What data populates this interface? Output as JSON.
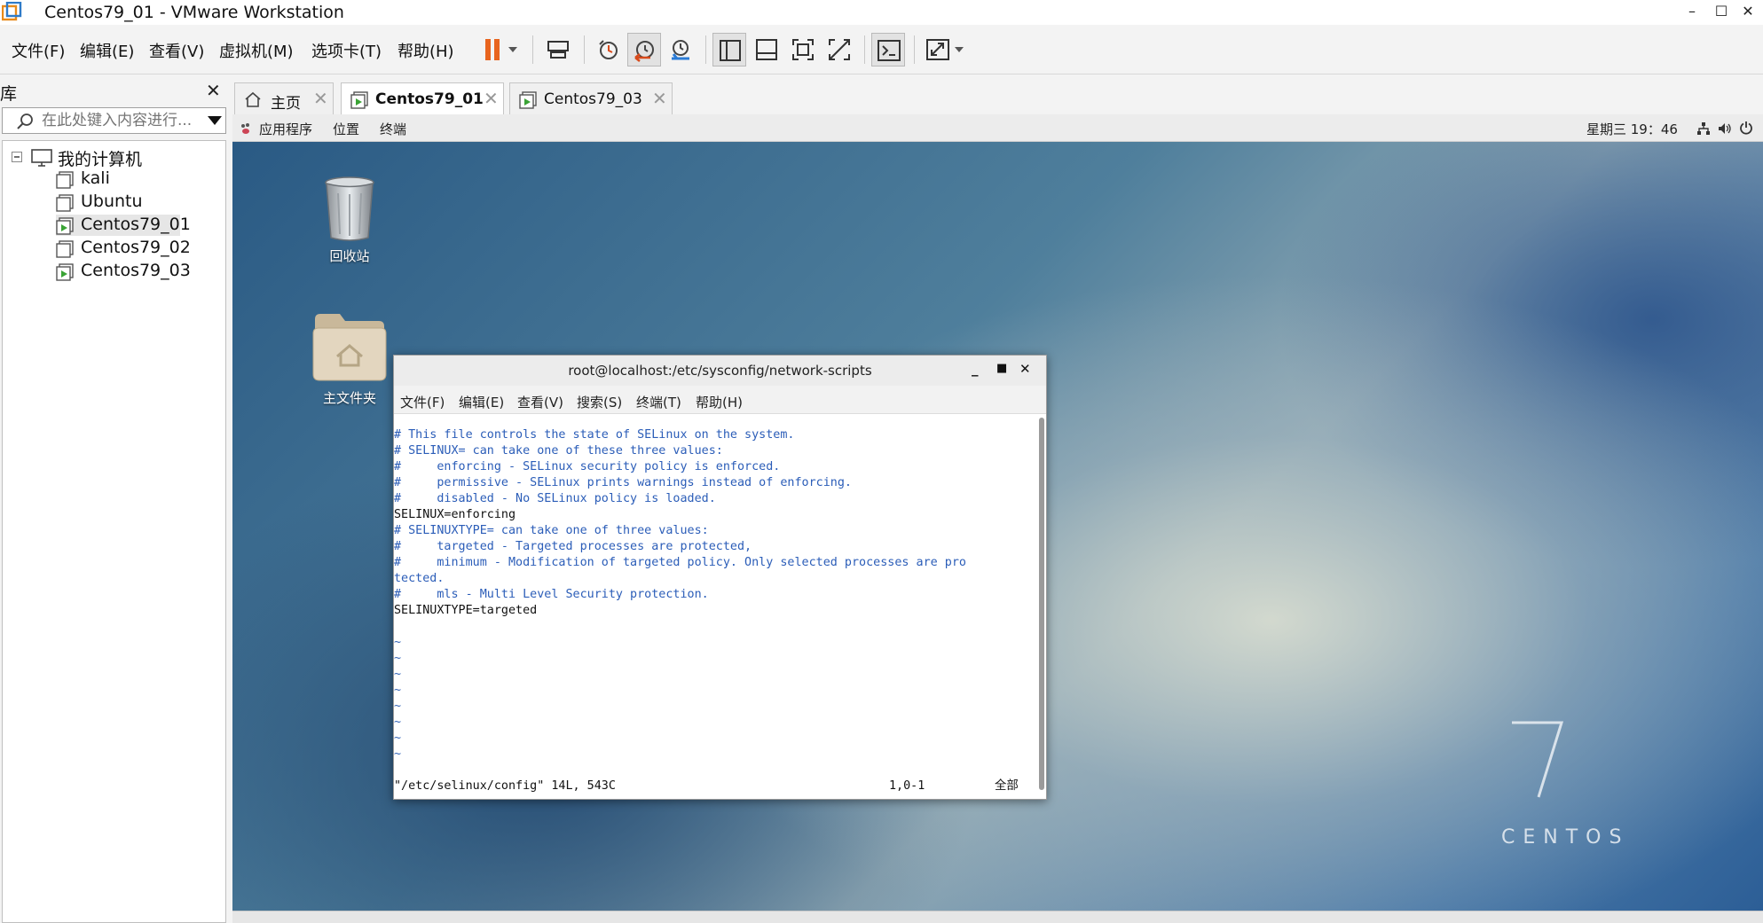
{
  "window": {
    "title": "Centos79_01 - VMware Workstation",
    "minimize": "–",
    "maximize": "☐",
    "close": "✕"
  },
  "menubar": {
    "items": [
      "文件(F)",
      "编辑(E)",
      "查看(V)",
      "虚拟机(M)",
      "选项卡(T)",
      "帮助(H)"
    ]
  },
  "toolbar": {
    "icons": [
      "pause-icon",
      "send-keys-icon",
      "snapshot-icon",
      "revert-snapshot-icon",
      "snapshot-manager-icon",
      "library-view-icon",
      "thumbnail-view-icon",
      "fullscreen-icon",
      "unity-icon",
      "console-icon",
      "stretch-icon"
    ],
    "colors": {
      "pause": "#e8641e",
      "accent_blue": "#2a7bd6",
      "accent_red": "#d84a1b"
    }
  },
  "library": {
    "title": "库",
    "close": "✕",
    "search_placeholder": "在此处键入内容进行...",
    "root": "我的计算机",
    "vms": [
      {
        "name": "kali",
        "running": false
      },
      {
        "name": "Ubuntu",
        "running": false
      },
      {
        "name": "Centos79_01",
        "running": true,
        "selected": true
      },
      {
        "name": "Centos79_02",
        "running": false
      },
      {
        "name": "Centos79_03",
        "running": true
      }
    ]
  },
  "tabs": [
    {
      "label": "主页",
      "active": false
    },
    {
      "label": "Centos79_01",
      "active": true
    },
    {
      "label": "Centos79_03",
      "active": false
    }
  ],
  "guest": {
    "topbar": {
      "apps": "应用程序",
      "places": "位置",
      "terminal": "终端",
      "clock": "星期三 19：46"
    },
    "desktop_icons": [
      {
        "label": "回收站",
        "icon": "trash-icon"
      },
      {
        "label": "主文件夹",
        "icon": "home-folder-icon"
      }
    ],
    "brand": {
      "numeral": "7",
      "word": "CENTOS"
    },
    "terminal": {
      "title": "root@localhost:/etc/sysconfig/network-scripts",
      "menu": [
        "文件(F)",
        "编辑(E)",
        "查看(V)",
        "搜索(S)",
        "终端(T)",
        "帮助(H)"
      ],
      "lines": [
        {
          "text": "# This file controls the state of SELinux on the system.",
          "kind": "comment"
        },
        {
          "text": "# SELINUX= can take one of these three values:",
          "kind": "comment"
        },
        {
          "text": "#     enforcing - SELinux security policy is enforced.",
          "kind": "comment"
        },
        {
          "text": "#     permissive - SELinux prints warnings instead of enforcing.",
          "kind": "comment"
        },
        {
          "text": "#     disabled - No SELinux policy is loaded.",
          "kind": "comment"
        },
        {
          "text": "SELINUX=enforcing",
          "kind": "normal"
        },
        {
          "text": "# SELINUXTYPE= can take one of three values:",
          "kind": "comment"
        },
        {
          "text": "#     targeted - Targeted processes are protected,",
          "kind": "comment"
        },
        {
          "text": "#     minimum - Modification of targeted policy. Only selected processes are pro",
          "kind": "comment"
        },
        {
          "text": "tected.",
          "kind": "comment"
        },
        {
          "text": "#     mls - Multi Level Security protection.",
          "kind": "comment"
        },
        {
          "text": "SELINUXTYPE=targeted",
          "kind": "normal"
        },
        {
          "text": "",
          "kind": "normal"
        },
        {
          "text": "~",
          "kind": "tilde"
        },
        {
          "text": "~",
          "kind": "tilde"
        },
        {
          "text": "~",
          "kind": "tilde"
        },
        {
          "text": "~",
          "kind": "tilde"
        },
        {
          "text": "~",
          "kind": "tilde"
        },
        {
          "text": "~",
          "kind": "tilde"
        },
        {
          "text": "~",
          "kind": "tilde"
        },
        {
          "text": "~",
          "kind": "tilde"
        }
      ],
      "status_file": "\"/etc/selinux/config\" 14L, 543C",
      "status_pos": "1,0-1",
      "status_all": "全部"
    }
  }
}
